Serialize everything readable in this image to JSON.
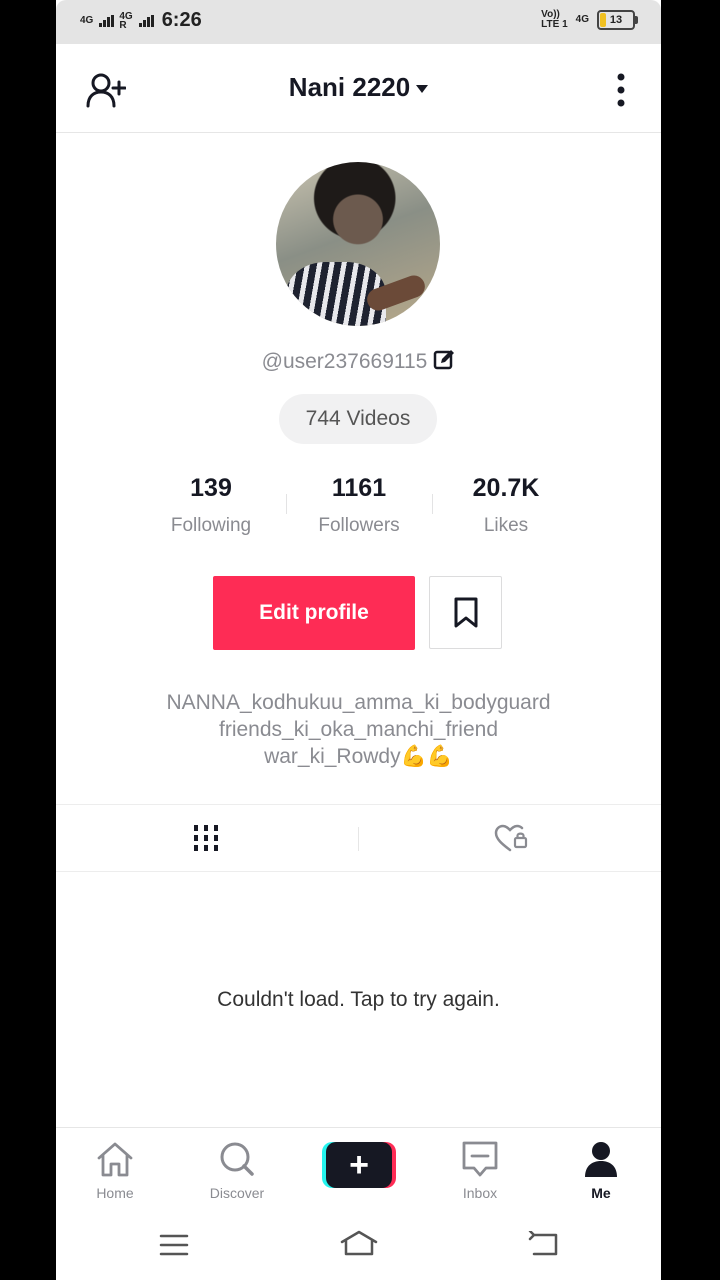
{
  "status_bar": {
    "network1": "4G",
    "network2": "4G",
    "network2_sub": "R",
    "time": "6:26",
    "volte_line1": "Vo))",
    "volte_line2": "LTE 1",
    "data_type": "4G",
    "battery": "13"
  },
  "header": {
    "title": "Nani 2220",
    "add_friend_icon": "add-user-icon",
    "more_icon": "kebab-icon"
  },
  "profile": {
    "username": "@user237669115",
    "videos_count": "744 Videos",
    "stats": [
      {
        "value": "139",
        "label": "Following"
      },
      {
        "value": "1161",
        "label": "Followers"
      },
      {
        "value": "20.7K",
        "label": "Likes"
      }
    ],
    "edit_button": "Edit profile",
    "bio_lines": [
      "NANNA_kodhukuu_amma_ki_bodyguard",
      "friends_ki_oka_manchi_friend",
      "war_ki_Rowdy💪💪"
    ]
  },
  "tabs": [
    {
      "icon": "videos-grid-icon"
    },
    {
      "icon": "liked-private-icon"
    }
  ],
  "content": {
    "error_message": "Couldn't load. Tap to try again."
  },
  "bottom_nav": [
    {
      "label": "Home",
      "icon": "home-icon"
    },
    {
      "label": "Discover",
      "icon": "search-icon"
    },
    {
      "label": "",
      "icon": "create-icon"
    },
    {
      "label": "Inbox",
      "icon": "inbox-icon"
    },
    {
      "label": "Me",
      "icon": "profile-icon"
    }
  ],
  "colors": {
    "accent": "#fe2c55",
    "cyan": "#25f4ee",
    "text_primary": "#161823",
    "text_secondary": "#8a8b91"
  }
}
